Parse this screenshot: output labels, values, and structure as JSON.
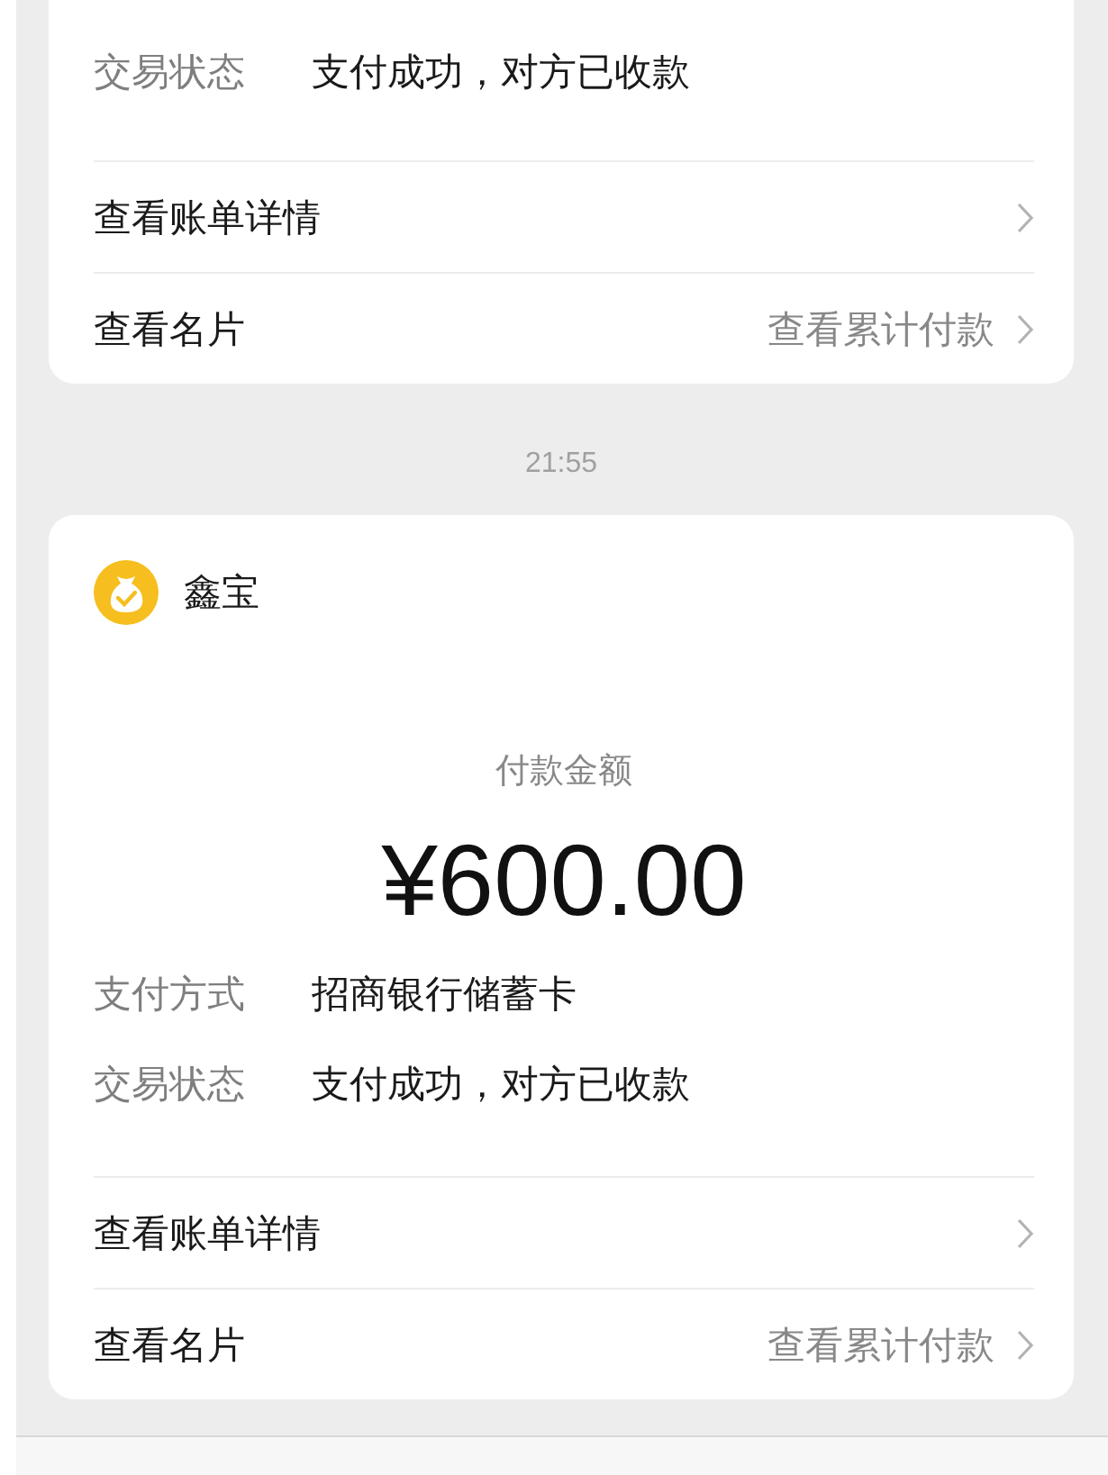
{
  "feed": [
    {
      "kind": "card",
      "details": [
        {
          "label": "交易状态",
          "value": "支付成功，对方已收款"
        }
      ],
      "links": [
        {
          "label": "查看账单详情"
        },
        {
          "label": "查看名片",
          "value": "查看累计付款"
        }
      ]
    },
    {
      "kind": "time",
      "text": "21:55"
    },
    {
      "kind": "card",
      "merchant": "鑫宝",
      "amount_label": "付款金额",
      "amount": "¥600.00",
      "details": [
        {
          "label": "支付方式",
          "value": "招商银行储蓄卡"
        },
        {
          "label": "交易状态",
          "value": "支付成功，对方已收款"
        }
      ],
      "links": [
        {
          "label": "查看账单详情"
        },
        {
          "label": "查看名片",
          "value": "查看累计付款"
        }
      ]
    }
  ]
}
